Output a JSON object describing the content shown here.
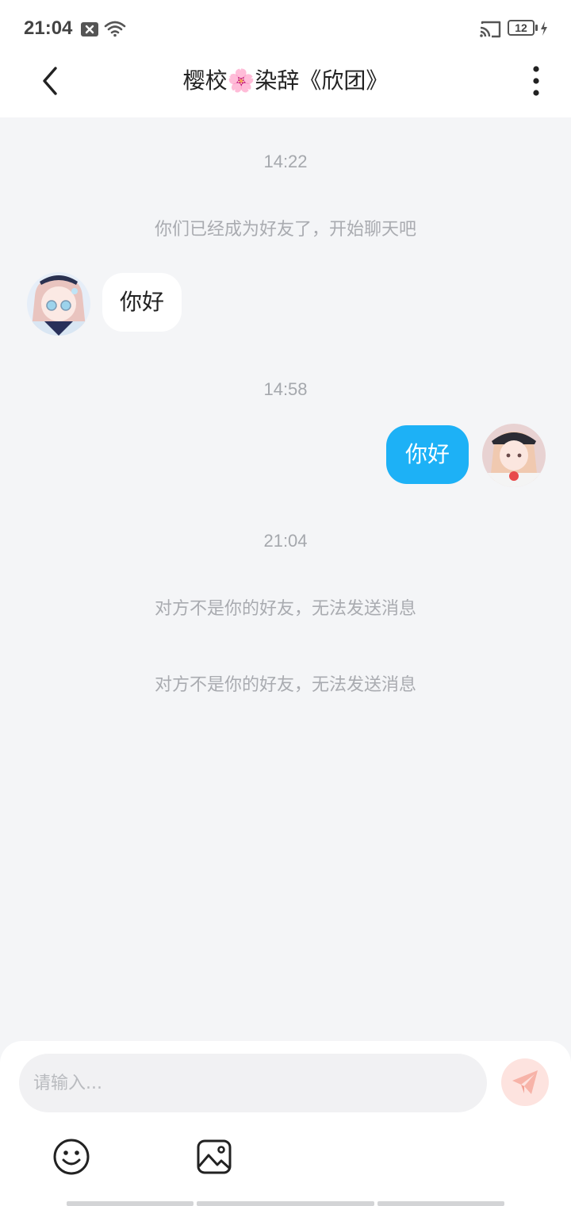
{
  "status_bar": {
    "time": "21:04",
    "battery": "12",
    "icons": [
      "notification-x-icon",
      "wifi-icon",
      "cast-icon",
      "battery-icon",
      "charging-bolt-icon"
    ]
  },
  "nav": {
    "back_icon": "chevron-left-icon",
    "title": "樱校🌸染辞《欣团》",
    "menu_icon": "more-vertical-icon"
  },
  "messages": {
    "time_1": "14:22",
    "system_friend_added": "你们已经成为好友了，开始聊天吧",
    "incoming_text": "你好",
    "time_2": "14:58",
    "outgoing_text": "你好",
    "time_3": "21:04",
    "system_not_friend_1": "对方不是你的好友，无法发送消息",
    "system_not_friend_2": "对方不是你的好友，无法发送消息"
  },
  "input": {
    "placeholder": "请输入...",
    "send_icon": "paper-plane-icon",
    "emoji_icon": "smiley-icon",
    "image_icon": "image-icon"
  },
  "colors": {
    "accent_blue": "#1db1f6",
    "send_button_disabled": "#fde3df",
    "background": "#f4f5f7"
  }
}
